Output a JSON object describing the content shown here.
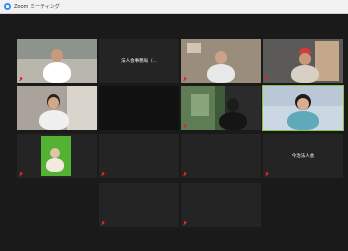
{
  "window": {
    "title": "Zoom ミーティング",
    "accent_color": "#2d8cff"
  },
  "tiles": [
    {
      "row": 0,
      "col": 0,
      "type": "video",
      "name": "",
      "muted": true
    },
    {
      "row": 0,
      "col": 1,
      "type": "name",
      "name": "法人会事務局（...",
      "muted": false
    },
    {
      "row": 0,
      "col": 2,
      "type": "video",
      "name": "",
      "muted": true
    },
    {
      "row": 0,
      "col": 3,
      "type": "video",
      "name": "",
      "muted": true
    },
    {
      "row": 1,
      "col": 0,
      "type": "video",
      "name": "",
      "muted": false
    },
    {
      "row": 1,
      "col": 1,
      "type": "blank",
      "name": "",
      "muted": false
    },
    {
      "row": 1,
      "col": 2,
      "type": "video",
      "name": "",
      "muted": true
    },
    {
      "row": 1,
      "col": 3,
      "type": "video",
      "name": "",
      "muted": false,
      "active": true
    },
    {
      "row": 2,
      "col": 0,
      "type": "video",
      "name": "",
      "muted": true
    },
    {
      "row": 2,
      "col": 1,
      "type": "name",
      "name": "",
      "muted": true
    },
    {
      "row": 2,
      "col": 2,
      "type": "name",
      "name": "",
      "muted": true
    },
    {
      "row": 2,
      "col": 3,
      "type": "name",
      "name": "今治法人会",
      "muted": true
    },
    {
      "row": 3,
      "col": 1,
      "type": "name",
      "name": "",
      "muted": true
    },
    {
      "row": 3,
      "col": 2,
      "type": "name",
      "name": "",
      "muted": true
    }
  ],
  "colors": {
    "background": "#1a1a1a",
    "tile": "#242424",
    "active_speaker": "#8ac43f",
    "muted": "#e02828"
  }
}
